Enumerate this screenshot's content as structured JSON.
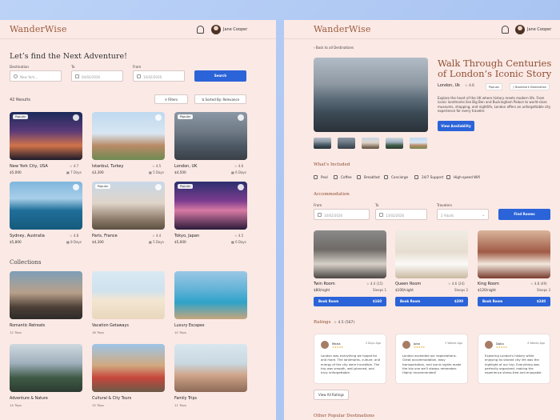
{
  "brand": "WanderWise",
  "user": {
    "name": "Jane Cooper"
  },
  "search": {
    "heading": "Let’s find the Next Adventure!",
    "destination_label": "Destination",
    "destination_placeholder": "New York...",
    "to_label": "To",
    "to_value": "04/02/2026",
    "from_label": "From",
    "from_value": "10/02/2026",
    "search_button": "Search"
  },
  "results": {
    "count_label": "42 Results",
    "filters_button": "Filters",
    "sort_button": "Sorted By: Relevance",
    "cards": [
      {
        "name": "New York City, USA",
        "rating": "4.7",
        "price": "$5,000",
        "days": "7 Days",
        "badge": "Popular"
      },
      {
        "name": "Istanbul, Turkey",
        "rating": "4.5",
        "price": "$3,300",
        "days": "5 Days",
        "badge": ""
      },
      {
        "name": "London, UK",
        "rating": "4.6",
        "price": "$4,500",
        "days": "6 Days",
        "badge": "Popular"
      },
      {
        "name": "Sydney, Australia",
        "rating": "4.8",
        "price": "$5,800",
        "days": "8 Days",
        "badge": ""
      },
      {
        "name": "Paris, France",
        "rating": "4.4",
        "price": "$4,300",
        "days": "5 Days",
        "badge": "Popular"
      },
      {
        "name": "Tokyo, Japan",
        "rating": "4.5",
        "price": "$5,000",
        "days": "6 Days",
        "badge": "Popular"
      }
    ]
  },
  "collections": {
    "heading": "Collections",
    "items": [
      {
        "title": "Romantic Retreats",
        "trips": "12 Trips"
      },
      {
        "title": "Vacation Getaways",
        "trips": "18 Trips"
      },
      {
        "title": "Luxury Escapes",
        "trips": "10 Trips"
      },
      {
        "title": "Adventure & Nature",
        "trips": "14 Trips"
      },
      {
        "title": "Cultural & City Tours",
        "trips": "15 Trips"
      },
      {
        "title": "Family Trips",
        "trips": "11 Trips"
      }
    ]
  },
  "detail": {
    "back_link": "Back to all Destinations",
    "title_line1": "Walk Through Centuries",
    "title_line2": "of London’s Iconic Story",
    "location": "London, Uk",
    "rating": "4.6",
    "popular_badge": "Popular",
    "bookmark": "Bookmark Destination",
    "description": "Explore the heart of the UK where history meets modern life. From iconic landmarks like Big Ben and Buckingham Palace to world-class museums, shopping, and nightlife, London offers an unforgettable city experience for every traveler.",
    "view_availability": "View Availability",
    "included_heading": "What’s Included",
    "included": [
      "Pool",
      "Coffee",
      "Breakfast",
      "Concierge",
      "24/7 Support",
      "High-speed Wifi"
    ],
    "accommodation_heading": "Accommodation",
    "acc_from_label": "From",
    "acc_from_value": "10/02/2026",
    "acc_to_label": "To",
    "acc_to_value": "13/02/2026",
    "travelers_label": "Travelers",
    "travelers_value": "2 Adults",
    "find_rooms": "Find Rooms",
    "rooms": [
      {
        "name": "Twin Room",
        "rating": "4.4 (15)",
        "price": "$80/night",
        "sleeps": "Sleeps 1",
        "book": "Book Room",
        "total": "$160"
      },
      {
        "name": "Queen Room",
        "rating": "4.6 (24)",
        "price": "$100/night",
        "sleeps": "Sleeps 2",
        "book": "Book Room",
        "total": "$200"
      },
      {
        "name": "King Room",
        "rating": "4.8 (49)",
        "price": "$120/night",
        "sleeps": "Sleeps 3",
        "book": "Book Room",
        "total": "$240"
      }
    ],
    "ratings_heading": "Ratings",
    "ratings_value": "4.5",
    "ratings_count": "(567)",
    "reviews": [
      {
        "name": "Maria",
        "date": "3 Days Ago",
        "text": "London was everything we hoped for and more. The landmarks, culture, and energy of the city were incredible. The trip was smooth, well-planned, and truly unforgettable."
      },
      {
        "name": "John",
        "date": "2 Weeks Ago",
        "text": "London exceeded our expectations. Great accommodation, easy transportation, and iconic sights made the trip one we'll always remember. Highly recommended!"
      },
      {
        "name": "Dalia",
        "date": "4 Weeks Ago",
        "text": "Exploring London's history while enjoying its vibrant city life was the highlight of our trip. Everything was perfectly organized, making the experience stress-free and enjoyable."
      }
    ],
    "view_all_ratings": "View All Ratings",
    "other_heading": "Other Popular Destinations"
  }
}
